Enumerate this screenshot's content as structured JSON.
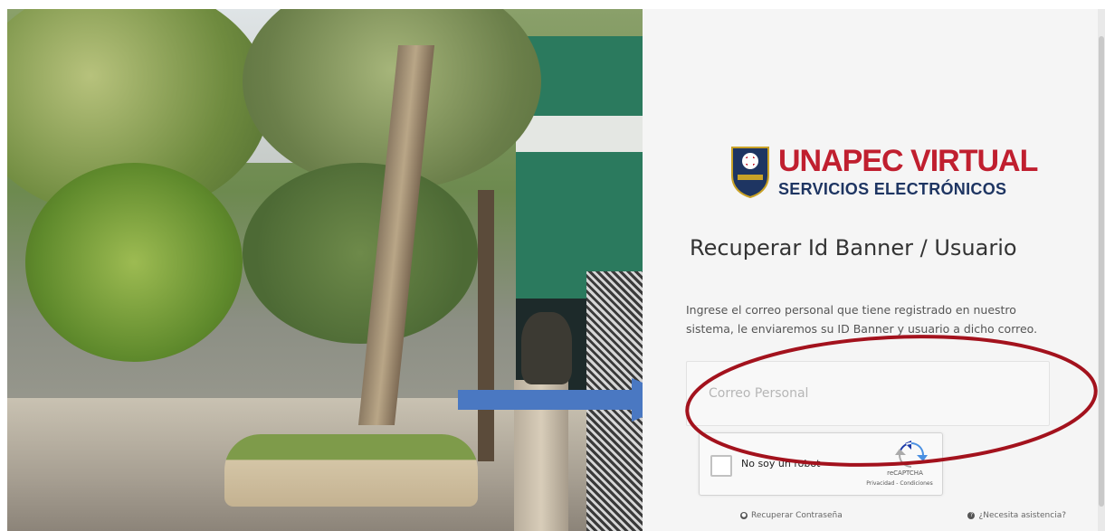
{
  "brand": {
    "name": "UNAPEC VIRTUAL",
    "subtitle": "SERVICIOS ELECTRÓNICOS",
    "primary_color": "#c01f2f",
    "secondary_color": "#1e3562"
  },
  "form": {
    "title": "Recuperar Id Banner / Usuario",
    "instructions": "Ingrese el correo personal que tiene registrado en nuestro sistema, le enviaremos su ID Banner y usuario a dicho correo.",
    "email_placeholder": "Correo Personal",
    "email_value": ""
  },
  "recaptcha": {
    "checkbox_label": "No soy un robot",
    "brand": "reCAPTCHA",
    "links": "Privacidad - Condiciones"
  },
  "links": {
    "recover_password": "Recuperar Contraseña",
    "need_help": "¿Necesita asistencia?"
  },
  "annotations": {
    "arrow_color": "#4a78c2",
    "ellipse_color": "#a3121d"
  }
}
